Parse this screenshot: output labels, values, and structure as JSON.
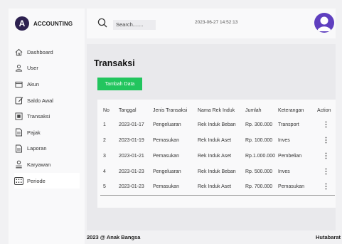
{
  "brand": {
    "logo_letter": "A",
    "name": "ACCOUNTING"
  },
  "sidebar": {
    "items": [
      {
        "label": "Dashboard",
        "icon": "home-icon"
      },
      {
        "label": "User",
        "icon": "user-icon"
      },
      {
        "label": "Akun",
        "icon": "wallet-icon"
      },
      {
        "label": "Saldo Awal",
        "icon": "edit-icon"
      },
      {
        "label": "Transaksi",
        "icon": "transaction-icon"
      },
      {
        "label": "Pajak",
        "icon": "document-icon"
      },
      {
        "label": "Laporan",
        "icon": "report-icon"
      },
      {
        "label": "Karyawan",
        "icon": "employee-icon"
      },
      {
        "label": "Periode",
        "icon": "calendar-icon",
        "active": true
      }
    ]
  },
  "topbar": {
    "search_text": "Search.......",
    "datetime": "2023-06-27 14:52:13"
  },
  "main": {
    "title": "Transaksi",
    "add_button": "Tambah Data",
    "table": {
      "headers": [
        "No",
        "Tanggal",
        "Jenis Transaksi",
        "Nama Rek Induk",
        "Jumlah",
        "Keterangan",
        "Action"
      ],
      "rows": [
        [
          "1",
          "2023-01-17",
          "Pengeluaran",
          "Rek Induk Beban",
          "Rp. 300.000",
          "Transport",
          "⋮"
        ],
        [
          "2",
          "2023-01-19",
          "Pemasukan",
          "Rek Induk Aset",
          "Rp. 100.000",
          "Inves",
          "⋮"
        ],
        [
          "3",
          "2023-01-21",
          "Pemasukan",
          "Rek Induk Aset",
          "Rp.1.000.000",
          "Pembelian",
          "⋮"
        ],
        [
          "4",
          "2023-01-23",
          "Pengeluaran",
          "Rek Induk Beban",
          "Rp. 500.000",
          "Inves",
          "⋮"
        ],
        [
          "5",
          "2023-01-23",
          "Pemasukan",
          "Rek Induk Aset",
          "Rp. 700.000",
          "Pemasukan",
          "⋮"
        ]
      ]
    }
  },
  "footer": {
    "left": "2023 @ Anak Bangsa",
    "right": "Hutabarat"
  },
  "colors": {
    "accent_button": "#22c55e",
    "brand_logo": "#2d2150",
    "avatar": "#5f3fbf"
  }
}
